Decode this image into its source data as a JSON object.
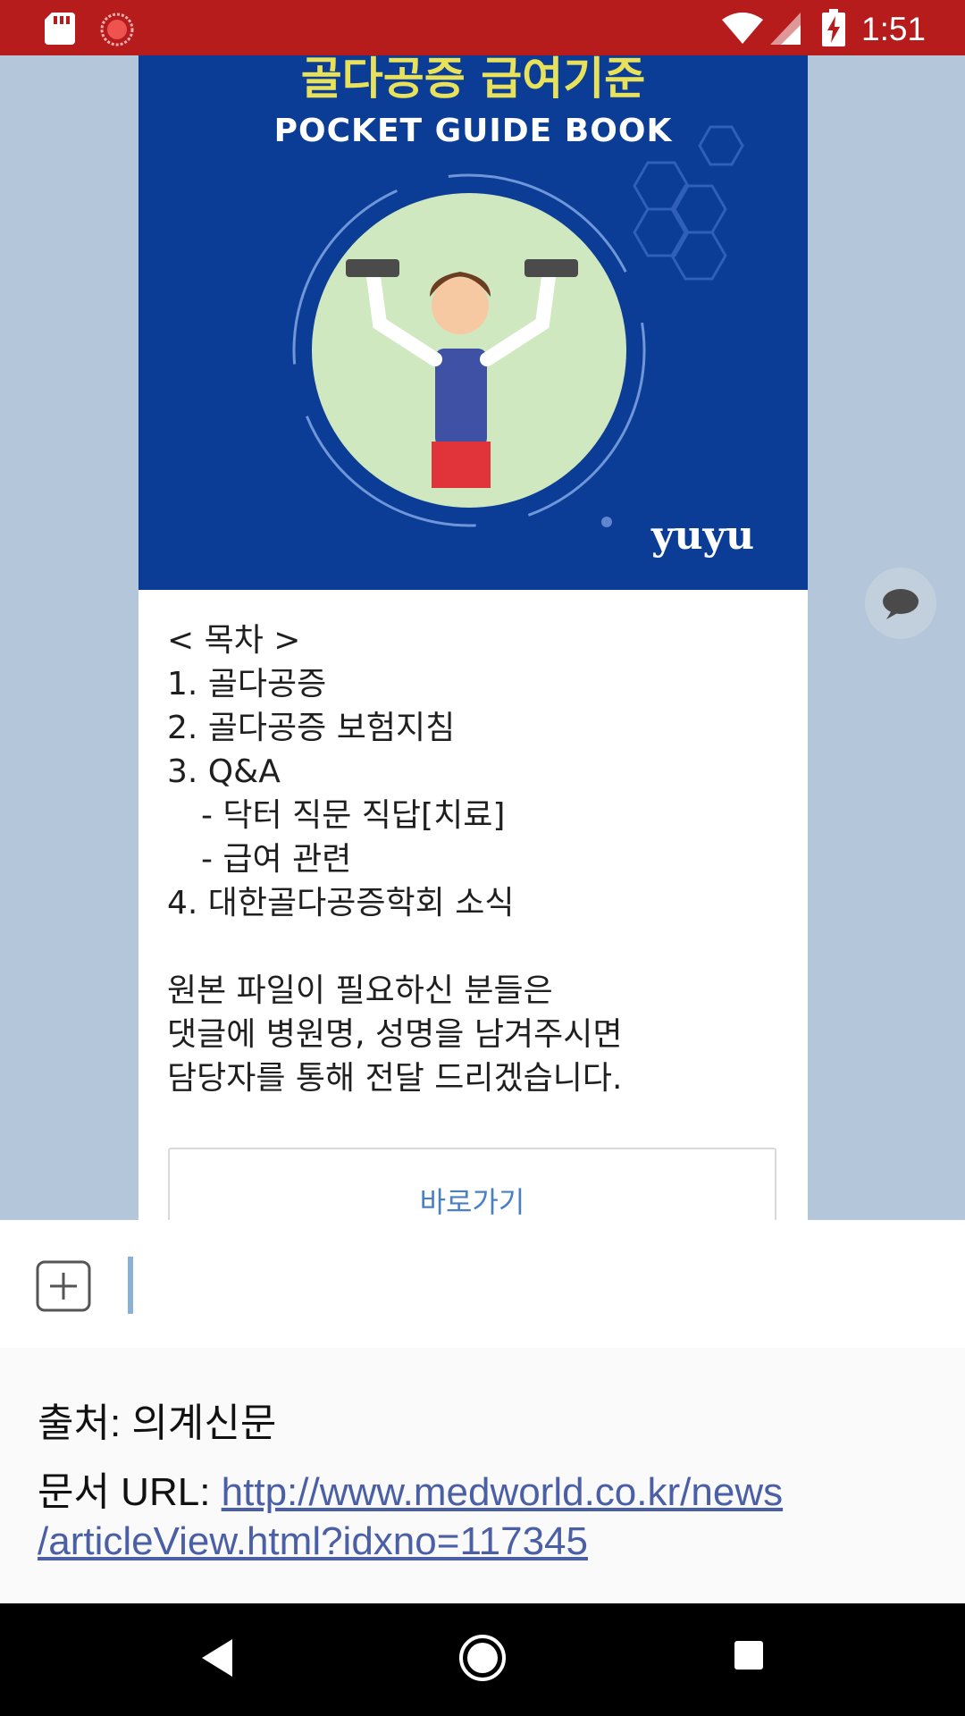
{
  "status_bar": {
    "time": "1:51",
    "icons": [
      "sd-card-icon",
      "screen-record-icon",
      "wifi-icon",
      "cell-signal-icon",
      "battery-charging-icon"
    ]
  },
  "post": {
    "cover_title": "골다공증 급여기준",
    "cover_subtitle": "POCKET GUIDE BOOK",
    "logo": "yuyu",
    "body_lines": [
      "< 목차 >",
      "1. 골다공증",
      "2. 골다공증 보험지침",
      "3. Q&A",
      "- 닥터 직문 직답[치료]",
      "- 급여 관련",
      "4. 대한골다공증학회 소식",
      "원본 파일이 필요하신 분들은",
      "댓글에 병원명, 성명을 남겨주시면",
      "담당자를 통해 전달 드리겠습니다."
    ],
    "link_button_label": "바로가기"
  },
  "input_bar": {
    "placeholder": ""
  },
  "source": {
    "source_text": "출처: 의계신문",
    "url_label": "문서 URL: ",
    "url_line1": "http://www.medworld.co.kr/news",
    "url_line2": "/articleView.html?idxno=117345"
  },
  "colors": {
    "status_bar": "#b71c1c",
    "chat_background": "#b3c6da",
    "cover_blue": "#0b3d96",
    "link_blue": "#4a5fa5"
  }
}
